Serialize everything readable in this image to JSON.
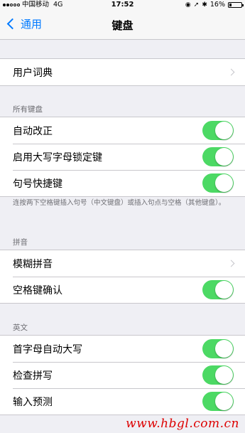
{
  "status_bar": {
    "carrier": "中国移动",
    "network": "4G",
    "time": "17:52",
    "battery": "16%",
    "battery_level": 0.16
  },
  "nav": {
    "back_label": "通用",
    "title": "键盘"
  },
  "groups": {
    "dictionary": {
      "rows": [
        {
          "label": "用户词典",
          "accessory": "chevron"
        }
      ]
    },
    "all_keyboards": {
      "header": "所有键盘",
      "rows": [
        {
          "label": "自动改正",
          "on": true
        },
        {
          "label": "启用大写字母锁定键",
          "on": true
        },
        {
          "label": "句号快捷键",
          "on": true
        }
      ],
      "footer": "连按两下空格键插入句号（中文键盘）或插入句点与空格（其他键盘）。"
    },
    "pinyin": {
      "header": "拼音",
      "rows": [
        {
          "label": "模糊拼音",
          "accessory": "chevron"
        },
        {
          "label": "空格键确认",
          "on": true
        }
      ]
    },
    "english": {
      "header": "英文",
      "rows": [
        {
          "label": "首字母自动大写",
          "on": true
        },
        {
          "label": "检查拼写",
          "on": true
        },
        {
          "label": "输入预测",
          "on": true
        }
      ]
    }
  },
  "watermark": "www.hbgl.com.cn",
  "colors": {
    "accent": "#007aff",
    "toggle_on": "#4cd964",
    "background": "#efeff4"
  }
}
